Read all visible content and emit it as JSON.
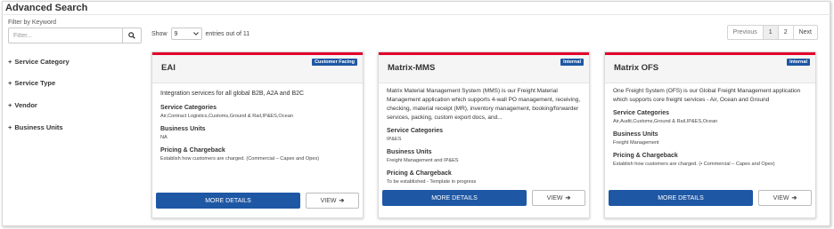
{
  "page": {
    "title": "Advanced Search"
  },
  "filter": {
    "label": "Filter by Keyword",
    "placeholder": "Filter...",
    "search_icon": "search-icon"
  },
  "facets": [
    {
      "label": "Service Category"
    },
    {
      "label": "Service Type"
    },
    {
      "label": "Vendor"
    },
    {
      "label": "Business Units"
    }
  ],
  "results": {
    "show_label": "Show",
    "page_size": "9",
    "entries_text": "entries out of 11"
  },
  "pagination": {
    "previous": "Previous",
    "pages": [
      "1",
      "2"
    ],
    "active_page": "1",
    "next": "Next"
  },
  "labels": {
    "service_categories": "Service Categories",
    "business_units": "Business Units",
    "pricing": "Pricing & Chargeback",
    "more_details": "MORE DETAILS",
    "view": "VIEW",
    "view_icon": "arrow-right-icon"
  },
  "cards": [
    {
      "title": "EAI",
      "badge": "Customer Facing",
      "badge_color": "#1e57a4",
      "description": "Integration services for all global B2B, A2A and B2C",
      "service_categories": "Air,Contract Logistics,Customs,Ground & Rail,IP&ES,Ocean",
      "business_units": "NA",
      "pricing": "Establish how customers are charged. (Commercial – Capex and Opex)"
    },
    {
      "title": "Matrix-MMS",
      "badge": "Internal",
      "badge_color": "#1e57a4",
      "description": "Matrix Material Management System (MMS) is our Freight Material Management application which supports 4-wall PO management, receiving, checking, material receipt (MR), inventory management, booking/forwarder services, packing, custom export docs, and...",
      "service_categories": "IP&ES",
      "business_units": "Freight Management and IP&ES",
      "pricing": "To be established - Template in progress"
    },
    {
      "title": "Matrix OFS",
      "badge": "Internal",
      "badge_color": "#1e57a4",
      "description": "One Freight System (OFS) is our Global Freight Management application which supports core freight services - Air, Ocean and Ground",
      "service_categories": "Air,Audit,Customs,Ground & Rail,IP&ES,Ocean",
      "business_units": "Freight Management",
      "pricing": "Establish how customers are charged. (• Commercial – Capex and Opex)"
    }
  ],
  "colors": {
    "accent_red": "#e4002b",
    "primary_blue": "#1e57a4"
  }
}
